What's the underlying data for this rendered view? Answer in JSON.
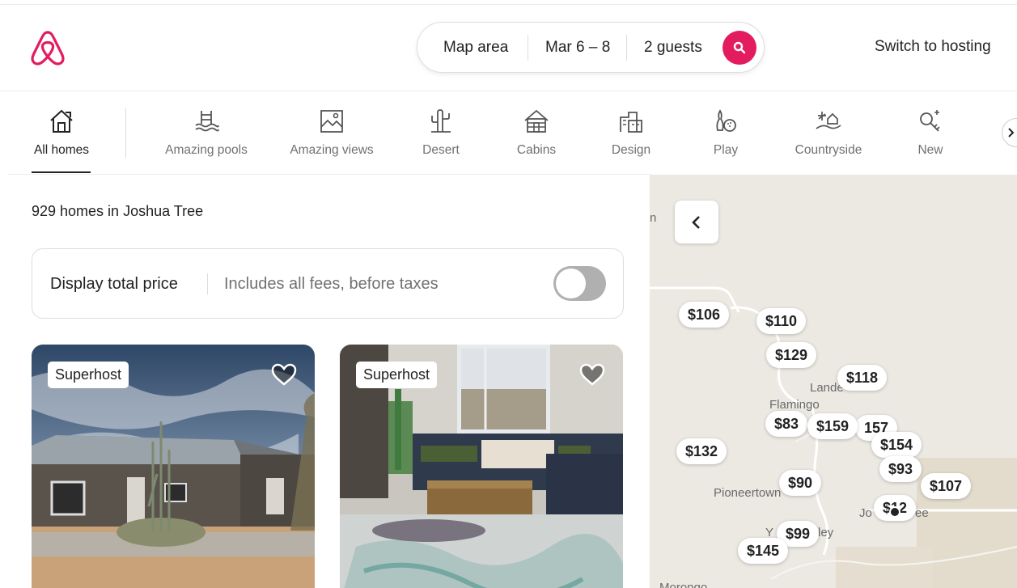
{
  "colors": {
    "brand": "#e31c5f",
    "text": "#222222",
    "muted": "#717171"
  },
  "header": {
    "logo_icon": "airbnb-logo",
    "search": {
      "location": "Map area",
      "dates": "Mar 6 – 8",
      "guests": "2 guests",
      "search_icon": "search-icon"
    },
    "host_link": "Switch to hosting"
  },
  "categories": [
    {
      "label": "All homes",
      "icon": "home-icon",
      "active": true
    },
    {
      "label": "Amazing pools",
      "icon": "pool-icon"
    },
    {
      "label": "Amazing views",
      "icon": "views-icon"
    },
    {
      "label": "Desert",
      "icon": "cactus-icon"
    },
    {
      "label": "Cabins",
      "icon": "cabin-icon"
    },
    {
      "label": "Design",
      "icon": "design-icon"
    },
    {
      "label": "Play",
      "icon": "bowling-icon"
    },
    {
      "label": "Countryside",
      "icon": "countryside-icon"
    },
    {
      "label": "New",
      "icon": "new-key-icon"
    }
  ],
  "results": {
    "count_text": "929 homes in Joshua Tree",
    "price_toggle": {
      "title": "Display total price",
      "subtitle": "Includes all fees, before taxes",
      "enabled": false
    },
    "listings": [
      {
        "badge": "Superhost",
        "favorite_icon": "heart-icon"
      },
      {
        "badge": "Superhost",
        "favorite_icon": "heart-icon"
      }
    ]
  },
  "map": {
    "back_icon": "chevron-left-icon",
    "places": [
      "n",
      "Lande",
      "Flamingo",
      "Pioneertown",
      "Jo",
      "ee",
      "Y",
      "ley",
      "Morongo"
    ],
    "pins": [
      "$106",
      "$110",
      "$129",
      "$118",
      "$83",
      "$159",
      "157",
      "$154",
      "$132",
      "$93",
      "$107",
      "$90",
      "$12",
      "$99",
      "$145"
    ]
  }
}
